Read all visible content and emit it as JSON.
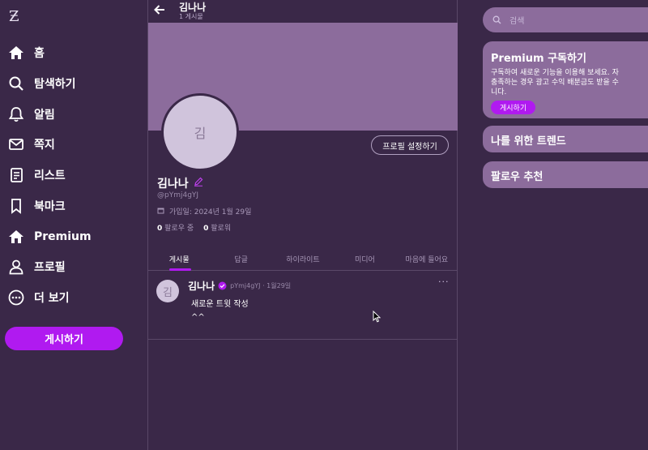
{
  "sidebar": {
    "logo": "Ƶ",
    "items": [
      {
        "label": "홈",
        "icon": "home-icon"
      },
      {
        "label": "탐색하기",
        "icon": "search-icon"
      },
      {
        "label": "알림",
        "icon": "bell-icon"
      },
      {
        "label": "쪽지",
        "icon": "mail-icon"
      },
      {
        "label": "리스트",
        "icon": "list-icon"
      },
      {
        "label": "북마크",
        "icon": "bookmark-icon"
      },
      {
        "label": "Premium",
        "icon": "premium-icon"
      },
      {
        "label": "프로필",
        "icon": "user-icon"
      },
      {
        "label": "더 보기",
        "icon": "more-icon"
      }
    ],
    "post_button": "게시하기"
  },
  "header": {
    "name": "김나나",
    "post_count": "1 게시물"
  },
  "profile": {
    "avatar_text": "김",
    "edit_button": "프로필 설정하기",
    "name": "김나나",
    "handle": "@pYmj4gYJ",
    "joined": "가입일: 2024년 1월 29일",
    "following_count": "0",
    "following_label": "팔로우 중",
    "followers_count": "0",
    "followers_label": "팔로워"
  },
  "tabs": [
    "게시물",
    "답글",
    "하이라이트",
    "미디어",
    "마음에 들어요"
  ],
  "post": {
    "avatar_text": "김",
    "name": "김나나",
    "meta": "pYmj4gYJ · 1월29일",
    "more": "···",
    "line1": "새로운 트윗 작성",
    "line2": "^^"
  },
  "right": {
    "search_placeholder": "검색",
    "premium_title": "Premium 구독하기",
    "premium_desc": "구독하여 새로운 기능을 이용해 보세요. 자\n충족하는 경우 광고 수익 배분금도 받을 수\n니다.",
    "premium_button": "게시하기",
    "trends_title": "나를 위한 트렌드",
    "follow_title": "팔로우 추천"
  },
  "colors": {
    "background": "#3a2848",
    "card": "#8c6c9c",
    "accent": "#b01af0"
  }
}
